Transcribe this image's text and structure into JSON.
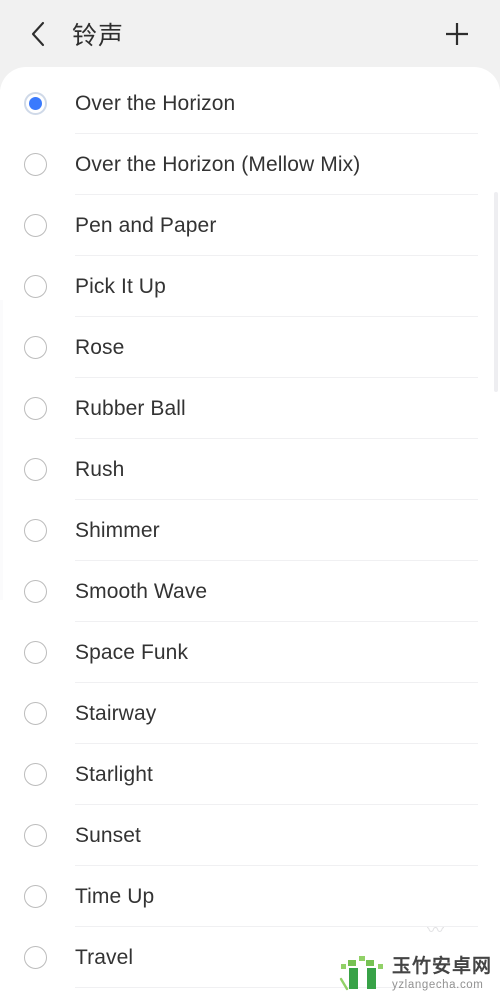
{
  "header": {
    "title": "铃声",
    "back_icon": "chevron-left-icon",
    "add_icon": "plus-icon"
  },
  "list": {
    "items": [
      {
        "label": "Over the Horizon",
        "selected": true
      },
      {
        "label": "Over the Horizon (Mellow Mix)",
        "selected": false
      },
      {
        "label": "Pen and Paper",
        "selected": false
      },
      {
        "label": "Pick It Up",
        "selected": false
      },
      {
        "label": "Rose",
        "selected": false
      },
      {
        "label": "Rubber Ball",
        "selected": false
      },
      {
        "label": "Rush",
        "selected": false
      },
      {
        "label": "Shimmer",
        "selected": false
      },
      {
        "label": "Smooth Wave",
        "selected": false
      },
      {
        "label": "Space Funk",
        "selected": false
      },
      {
        "label": "Stairway",
        "selected": false
      },
      {
        "label": "Starlight",
        "selected": false
      },
      {
        "label": "Sunset",
        "selected": false
      },
      {
        "label": "Time Up",
        "selected": false
      },
      {
        "label": "Travel",
        "selected": false
      }
    ]
  },
  "watermark": {
    "name": "玉竹安卓网",
    "url": "yzlangecha.com"
  },
  "colors": {
    "accent": "#3a7afd",
    "header_bg": "#f1f1f1",
    "card_bg": "#ffffff",
    "text": "#333333",
    "divider": "#f0f0f2",
    "radio_border": "#bcbcbc",
    "watermark_green": "#2e9e3e"
  }
}
